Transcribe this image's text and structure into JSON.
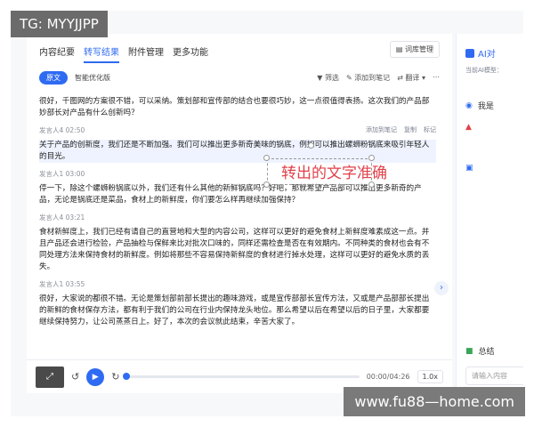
{
  "watermark_top": "TG: MYYJJPP",
  "watermark_bottom": "www.fu88—home.com",
  "tabs": [
    "内容纪要",
    "转写结果",
    "附件管理",
    "更多功能"
  ],
  "library_button": "词库管理",
  "subbar": {
    "original": "原文",
    "smart": "智能优化版",
    "filter": "筛选",
    "add_note": "添加到笔记",
    "translate": "翻译"
  },
  "transcript": [
    {
      "text": "很好，千图网的方案很不错，可以采纳。策划部和宣传部的结合也要很巧妙，这一点很值得表扬。这次我们的产品部妙部长对产品有什么创新吗？"
    },
    {
      "speaker": "发言人4 02:50",
      "tools": [
        "添加到笔记",
        "复制",
        "标记"
      ],
      "text": "关于产品的创新度，我们还是不断加强。我们可以推出更多新奇美味的锅底，例如可以推出螺蛳粉锅底来吸引年轻人的目光。"
    },
    {
      "speaker": "发言人1 03:00",
      "text": "停一下，除这个螺蛳粉锅底以外，我们还有什么其他的新鲜锅底吗？好吧，那就希望产品部可以推出更多新奇的产品，无论是锅底还是菜品，食材上的新鲜度，你们要怎么样再继续加强保持？"
    },
    {
      "speaker": "发言人4 03:21",
      "text": "食材新鲜度上，我们已经有请自己的直营地和大型的内容公司，这样可以更好的避免食材上新鲜度难素成这一点。并且产品还会进行检验，产品抽检与保鲜来比对批次口味的，同样还需检查是否在有效期内。不同种类的食材也会有不同处理方法来保持食材的新鲜度。例如将那些不容易保持新鲜度的食材进行掉水处理，这样可以更好的避免水质的丢失。"
    },
    {
      "speaker": "发言人1 03:55",
      "text": "很好，大家说的都很不错。无论是策划部前部长提出的趣味游戏，或是宣传部部长宣传方法，又或是产品部部长提出的新鲜的食材保存方法，都有利于我们的公司在行业内保持龙头地位。那么希望以后在希望以后的日子里，大家都要继续保持努力，让公司蒸蒸日上。好了，本次的会议就此结束，辛苦大家了。"
    }
  ],
  "overlay_text": "转出的文字准确",
  "player": {
    "time": "00:00/04:26",
    "speed": "1.0x",
    "progress": 0.0
  },
  "right_panel": {
    "title": "AI对",
    "subtitle": "当前AI模型：",
    "row1": "我是",
    "row2": "总结",
    "input_placeholder": "请输入内容"
  }
}
